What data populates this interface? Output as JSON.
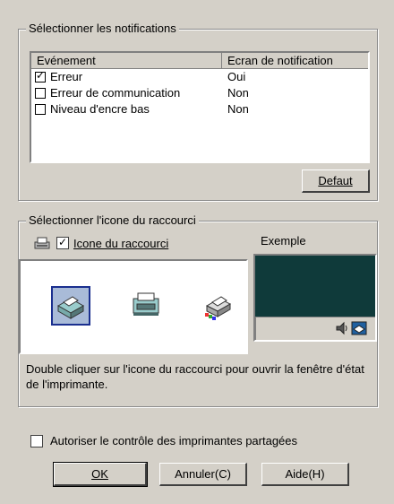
{
  "notifications": {
    "group_label": "Sélectionner les notifications",
    "columns": [
      "Evénement",
      "Ecran de notification"
    ],
    "rows": [
      {
        "label": "Erreur",
        "value": "Oui",
        "checked": true
      },
      {
        "label": "Erreur de communication",
        "value": "Non",
        "checked": false
      },
      {
        "label": "Niveau d'encre bas",
        "value": "Non",
        "checked": false
      }
    ],
    "default_button": "Defaut"
  },
  "shortcut": {
    "group_label": "Sélectionner l'icone du raccourci",
    "checkbox_label": "Icone du raccourci",
    "checkbox_checked": true,
    "example_label": "Exemple",
    "description": "Double cliquer sur l'icone du raccourci pour ouvrir la fenêtre d'état de l'imprimante.",
    "selected_icon": 0,
    "icons": [
      "printer-icon",
      "printer-front-icon",
      "printer-color-icon"
    ]
  },
  "shared": {
    "checkbox_label": "Autoriser le contrôle des imprimantes partagées",
    "checked": false
  },
  "buttons": {
    "ok": "OK",
    "cancel": "Annuler(C)",
    "help": "Aide(H)"
  },
  "colors": {
    "window_bg": "#d4d0c8",
    "preview_bg": "#0f3a3a",
    "selection": "#1a2f8f"
  }
}
